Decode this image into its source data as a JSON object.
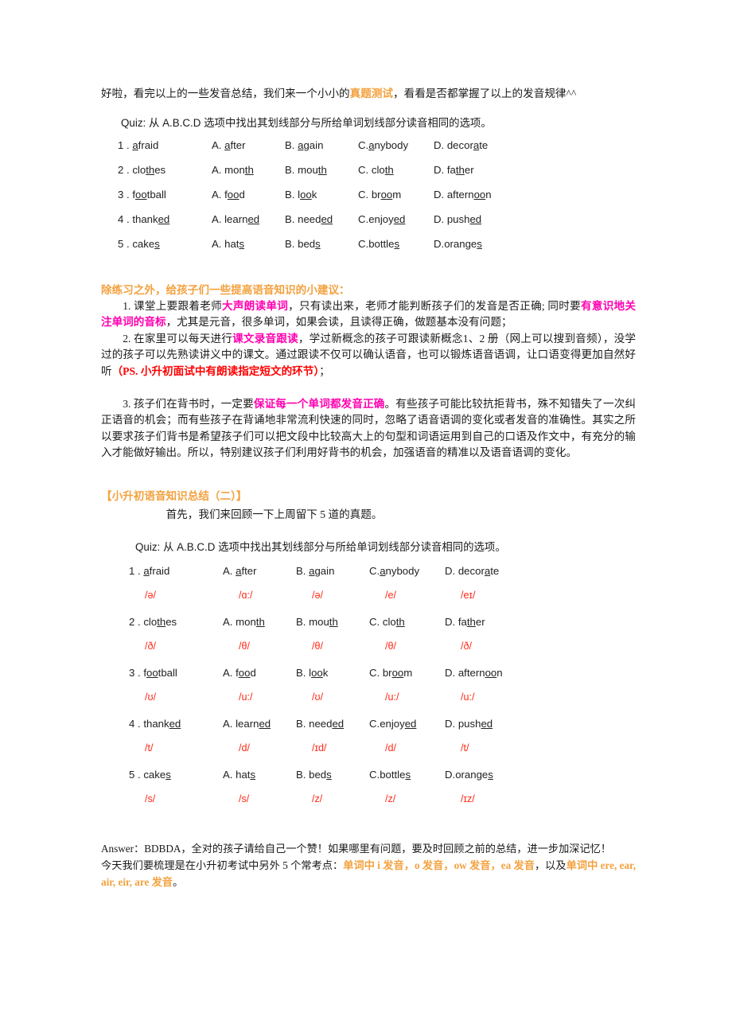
{
  "intro": {
    "lead_before": "好啦，看完以上的一些发音总结，我们来一个小小的",
    "lead_highlight": "真题测试",
    "lead_after": "，看看是否都掌握了以上的发音规律^^",
    "quiz_prompt": "Quiz: 从 A.B.C.D 选项中找出其划线部分与所给单词划线部分读音相同的选项。"
  },
  "quiz1": {
    "rows": [
      {
        "num": "1 .",
        "stem_pre": "",
        "stem_u": "a",
        "stem_post": "fraid",
        "options": [
          {
            "label": "A.",
            "pre": " ",
            "u": "a",
            "post": "fter"
          },
          {
            "label": "B.",
            "pre": " ",
            "u": "a",
            "post": "gain"
          },
          {
            "label": "C.",
            "pre": "",
            "u": "a",
            "post": "nybody"
          },
          {
            "label": "D.",
            "pre": " decor",
            "u": "a",
            "post": "te"
          }
        ]
      },
      {
        "num": "2 .",
        "stem_pre": "clo",
        "stem_u": "th",
        "stem_post": "es",
        "options": [
          {
            "label": "A.",
            "pre": " mon",
            "u": "th",
            "post": ""
          },
          {
            "label": "B.",
            "pre": " mou",
            "u": "th",
            "post": ""
          },
          {
            "label": "C.",
            "pre": " clo",
            "u": "th",
            "post": ""
          },
          {
            "label": "D.",
            "pre": " fa",
            "u": "th",
            "post": "er"
          }
        ]
      },
      {
        "num": "3 .",
        "stem_pre": "f",
        "stem_u": "oo",
        "stem_post": "tball",
        "options": [
          {
            "label": "A.",
            "pre": " f",
            "u": "oo",
            "post": "d"
          },
          {
            "label": "B.",
            "pre": " l",
            "u": "oo",
            "post": "k"
          },
          {
            "label": "C.",
            "pre": " br",
            "u": "oo",
            "post": "m"
          },
          {
            "label": "D.",
            "pre": " aftern",
            "u": "oo",
            "post": "n"
          }
        ]
      },
      {
        "num": "4 .",
        "stem_pre": "thank",
        "stem_u": "ed",
        "stem_post": "",
        "options": [
          {
            "label": "A.",
            "pre": " learn",
            "u": "ed",
            "post": ""
          },
          {
            "label": "B.",
            "pre": " need",
            "u": "ed",
            "post": ""
          },
          {
            "label": "C.",
            "pre": "enjoy",
            "u": "ed",
            "post": ""
          },
          {
            "label": "D.",
            "pre": " push",
            "u": "ed",
            "post": ""
          }
        ]
      },
      {
        "num": "5 .",
        "stem_pre": "cake",
        "stem_u": "s",
        "stem_post": "",
        "options": [
          {
            "label": "A.",
            "pre": " hat",
            "u": "s",
            "post": ""
          },
          {
            "label": "B.",
            "pre": " bed",
            "u": "s",
            "post": ""
          },
          {
            "label": "C.",
            "pre": "bottle",
            "u": "s",
            "post": ""
          },
          {
            "label": "D.",
            "pre": "orange",
            "u": "s",
            "post": ""
          }
        ]
      }
    ]
  },
  "advice": {
    "heading": "除练习之外，给孩子们一些提高语音知识的小建议：",
    "item1_a": "1. 课堂上要跟着老师",
    "item1_hl1": "大声朗读单词",
    "item1_b": "，只有读出来，老师才能判断孩子们的发音是否正确; 同时要",
    "item1_hl2": "有意识地关注单词的音标",
    "item1_c": "，尤其是元音，很多单词，如果会读，且读得正确，做题基本没有问题；",
    "item2_a": "2. 在家里可以每天进行",
    "item2_hl": "课文录音跟读",
    "item2_b": "，学过新概念的孩子可跟读新概念1、2 册（网上可以搜到音频），没学过的孩子可以先熟读讲义中的课文。通过跟读不仅可以确认语音，也可以锻炼语音语调，让口语变得更加自然好听",
    "item2_red": "（PS. 小升初面试中有朗读指定短文的环节）",
    "item2_c": "；",
    "item3_a": "3. 孩子们在背书时，一定要",
    "item3_hl": "保证每一个单词都发音正确",
    "item3_b": "。有些孩子可能比较抗拒背书，殊不知错失了一次纠正语音的机会；而有些孩子在背诵地非常流利快速的同时，忽略了语音语调的变化或者发音的准确性。其实之所以要求孩子们背书是希望孩子们可以把文段中比较高大上的句型和词语运用到自己的口语及作文中，有充分的输入才能做好输出。所以，特别建议孩子们利用好背书的机会，加强语音的精准以及语音语调的变化。"
  },
  "section2": {
    "heading": "【小升初语音知识总结（二）】",
    "recap": "首先，我们来回顾一下上周留下 5 道的真题。",
    "quiz_prompt": "Quiz: 从 A.B.C.D 选项中找出其划线部分与所给单词划线部分读音相同的选项。"
  },
  "quiz2": {
    "rows": [
      {
        "num": "1 .",
        "stem_pre": "",
        "stem_u": "a",
        "stem_post": "fraid",
        "stem_ipa": "/ə/",
        "options": [
          {
            "label": "A.",
            "pre": " ",
            "u": "a",
            "post": "fter",
            "ipa": "/ɑ:/"
          },
          {
            "label": "B.",
            "pre": " ",
            "u": "a",
            "post": "gain",
            "ipa": "/ə/"
          },
          {
            "label": "C.",
            "pre": "",
            "u": "a",
            "post": "nybody",
            "ipa": "/e/"
          },
          {
            "label": "D.",
            "pre": " decor",
            "u": "a",
            "post": "te",
            "ipa": "/eɪ/"
          }
        ]
      },
      {
        "num": "2 .",
        "stem_pre": "clo",
        "stem_u": "th",
        "stem_post": "es",
        "stem_ipa": "/ð/",
        "options": [
          {
            "label": "A.",
            "pre": " mon",
            "u": "th",
            "post": "",
            "ipa": "/θ/"
          },
          {
            "label": "B.",
            "pre": " mou",
            "u": "th",
            "post": "",
            "ipa": "/θ/"
          },
          {
            "label": "C.",
            "pre": " clo",
            "u": "th",
            "post": "",
            "ipa": "/θ/"
          },
          {
            "label": "D.",
            "pre": " fa",
            "u": "th",
            "post": "er",
            "ipa": "/ð/"
          }
        ]
      },
      {
        "num": "3 .",
        "stem_pre": "f",
        "stem_u": "oo",
        "stem_post": "tball",
        "stem_ipa": "/ʊ/",
        "options": [
          {
            "label": "A.",
            "pre": " f",
            "u": "oo",
            "post": "d",
            "ipa": "/u:/"
          },
          {
            "label": "B.",
            "pre": " l",
            "u": "oo",
            "post": "k",
            "ipa": "/ʊ/"
          },
          {
            "label": "C.",
            "pre": " br",
            "u": "oo",
            "post": "m",
            "ipa": "/u:/"
          },
          {
            "label": "D.",
            "pre": " aftern",
            "u": "oo",
            "post": "n",
            "ipa": "/u:/"
          }
        ]
      },
      {
        "num": "4 .",
        "stem_pre": "thank",
        "stem_u": "ed",
        "stem_post": "",
        "stem_ipa": "/t/",
        "options": [
          {
            "label": "A.",
            "pre": " learn",
            "u": "ed",
            "post": "",
            "ipa": "/d/"
          },
          {
            "label": "B.",
            "pre": " need",
            "u": "ed",
            "post": "",
            "ipa": "/ɪd/"
          },
          {
            "label": "C.",
            "pre": "enjoy",
            "u": "ed",
            "post": "",
            "ipa": "/d/"
          },
          {
            "label": "D.",
            "pre": " push",
            "u": "ed",
            "post": "",
            "ipa": "/t/"
          }
        ]
      },
      {
        "num": "5 .",
        "stem_pre": "cake",
        "stem_u": "s",
        "stem_post": "",
        "stem_ipa": "/s/",
        "options": [
          {
            "label": "A.",
            "pre": " hat",
            "u": "s",
            "post": "",
            "ipa": "/s/"
          },
          {
            "label": "B.",
            "pre": " bed",
            "u": "s",
            "post": "",
            "ipa": "/z/"
          },
          {
            "label": "C.",
            "pre": "bottle",
            "u": "s",
            "post": "",
            "ipa": "/z/"
          },
          {
            "label": "D.",
            "pre": "orange",
            "u": "s",
            "post": "",
            "ipa": "/ɪz/"
          }
        ]
      }
    ]
  },
  "answer": {
    "line1": "Answer：BDBDA，全对的孩子请给自己一个赞！如果哪里有问题，要及时回顾之前的总结，进一步加深记忆！",
    "line2_a": "今天我们要梳理是在小升初考试中另外 5 个常考点：",
    "line2_hl1": "单词中 i 发音，o 发音，ow 发音，ea 发音",
    "line2_b": "，以及",
    "line2_hl2": "单词中 ere, ear, air, eir, are 发音",
    "line2_c": "。"
  },
  "colors": {
    "orange": "#f3a13f",
    "magenta": "#ff00b0",
    "red": "#ff0000",
    "ipa_red": "#ff2a18"
  }
}
